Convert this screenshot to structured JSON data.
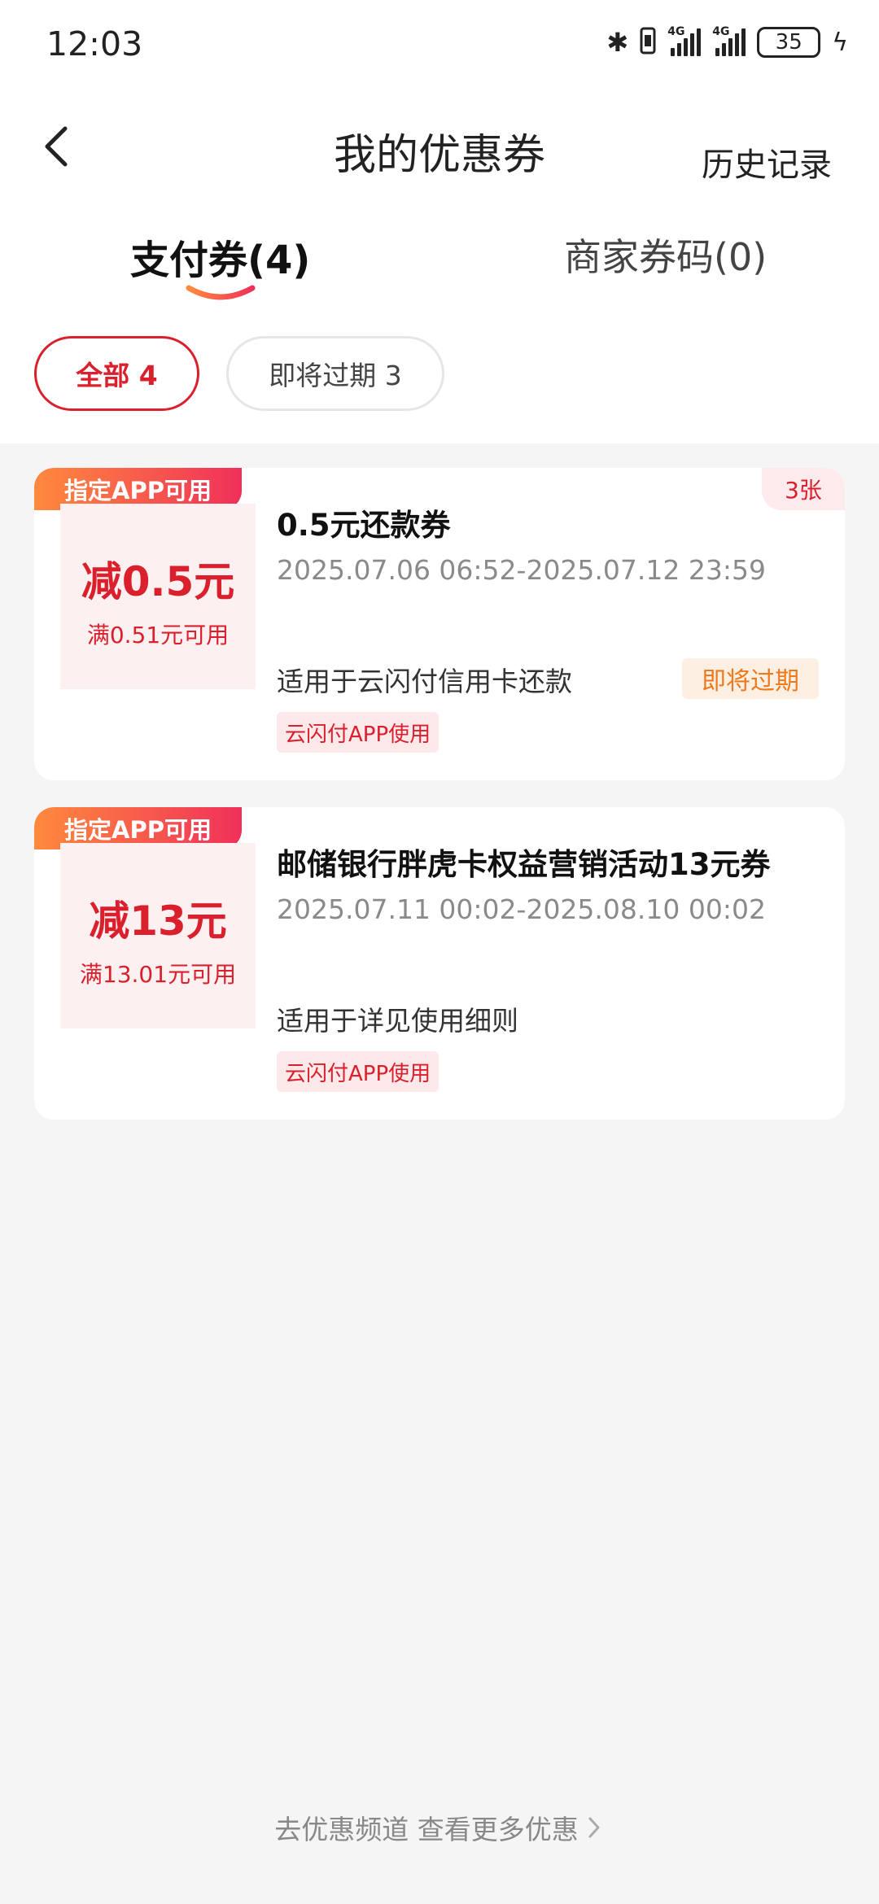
{
  "status_bar": {
    "time": "12:03",
    "battery": "35",
    "network_1": "4G",
    "network_2": "4G",
    "icons": [
      "bluetooth-icon",
      "vibrate-icon",
      "signal-icon",
      "signal-icon",
      "battery-icon",
      "charging-icon"
    ]
  },
  "header": {
    "title": "我的优惠券",
    "history_label": "历史记录",
    "back_icon": "chevron-left-icon"
  },
  "tabs": [
    {
      "label": "支付券(4)",
      "active": true
    },
    {
      "label": "商家券码(0)",
      "active": false
    }
  ],
  "filters": [
    {
      "label": "全部 4",
      "active": true
    },
    {
      "label": "即将过期 3",
      "active": false
    }
  ],
  "coupons": [
    {
      "app_tag": "指定APP可用",
      "discount": "减0.5元",
      "condition": "满0.51元可用",
      "title": "0.5元还款券",
      "date_range": "2025.07.06 06:52-2025.07.12 23:59",
      "scope": "适用于云闪付信用卡还款",
      "channel_tag": "云闪付APP使用",
      "count_badge": "3张",
      "expire_badge": "即将过期"
    },
    {
      "app_tag": "指定APP可用",
      "discount": "减13元",
      "condition": "满13.01元可用",
      "title": "邮储银行胖虎卡权益营销活动13元券",
      "date_range": "2025.07.11 00:02-2025.08.10 00:02",
      "scope": "适用于详见使用细则",
      "channel_tag": "云闪付APP使用"
    }
  ],
  "footer": {
    "link_label": "去优惠频道 查看更多优惠",
    "icon": "chevron-right-icon"
  },
  "colors": {
    "accent": "#d9202c",
    "tag_gradient_start": "#ff8a3d",
    "tag_gradient_end": "#f0305a",
    "expire_text": "#ee7a1e",
    "page_bg": "#f5f5f5"
  }
}
